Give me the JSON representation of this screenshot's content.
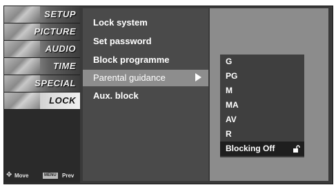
{
  "sidebar": {
    "items": [
      {
        "label": "SETUP",
        "icon": "setup-icon"
      },
      {
        "label": "PICTURE",
        "icon": "picture-icon"
      },
      {
        "label": "AUDIO",
        "icon": "audio-icon"
      },
      {
        "label": "TIME",
        "icon": "time-icon"
      },
      {
        "label": "SPECIAL",
        "icon": "special-icon"
      },
      {
        "label": "LOCK",
        "icon": "lock-icon",
        "active": true
      }
    ]
  },
  "help": {
    "move_label": "Move",
    "menu_key": "MENU",
    "prev_label": "Prev"
  },
  "lock_menu": {
    "items": [
      {
        "label": "Lock system"
      },
      {
        "label": "Set password"
      },
      {
        "label": "Block programme"
      },
      {
        "label": "Parental guidance",
        "active": true,
        "has_submenu": true
      },
      {
        "label": "Aux. block"
      }
    ]
  },
  "ratings": {
    "items": [
      {
        "label": "G"
      },
      {
        "label": "PG"
      },
      {
        "label": "M"
      },
      {
        "label": "MA"
      },
      {
        "label": "AV"
      },
      {
        "label": "R"
      },
      {
        "label": "Blocking Off",
        "selected": true,
        "icon": "unlocked-padlock-icon"
      }
    ]
  },
  "colors": {
    "frame": "#3a3a3a",
    "menu_bg": "#4a4a4a",
    "highlight": "#8d8d8d",
    "submenu_bg": "#3f3f3f",
    "selected_row": "#1e1e1e",
    "text": "#ffffff"
  }
}
